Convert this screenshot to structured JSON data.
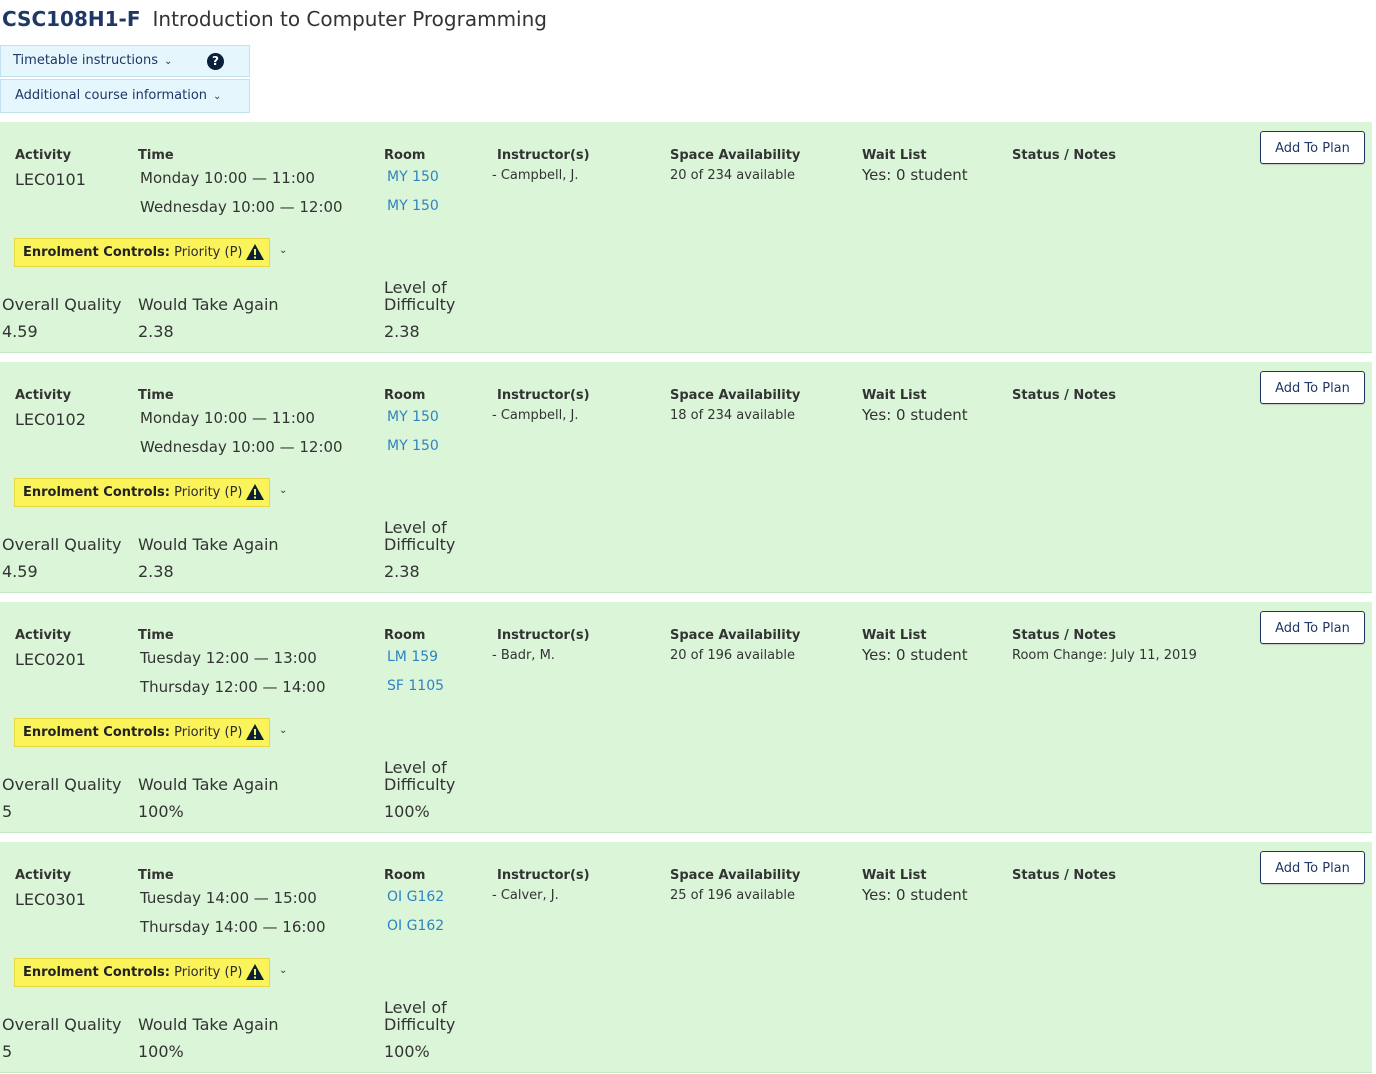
{
  "header": {
    "course_code": "CSC108H1-F",
    "course_title": "Introduction to Computer Programming"
  },
  "info_boxes": {
    "timetable_instructions": "Timetable instructions",
    "additional_info": "Additional course information",
    "help_icon": "?"
  },
  "labels": {
    "activity": "Activity",
    "time": "Time",
    "room": "Room",
    "instructors": "Instructor(s)",
    "space": "Space Availability",
    "waitlist": "Wait List",
    "status": "Status / Notes",
    "add_to_plan": "Add To Plan",
    "enrol_controls": "Enrolment Controls:",
    "overall_quality": "Overall Quality",
    "would_take_again": "Would Take Again",
    "level_of": "Level of",
    "difficulty": "Difficulty"
  },
  "icons": {
    "chevron": "chevron-down-icon",
    "warning": "warning-triangle-icon",
    "help": "question-circle-icon"
  },
  "colors": {
    "brand_navy": "#1e3765",
    "section_bg": "#dbf5d9",
    "enrol_bg": "#fbf35a",
    "room_link": "#2f83c2",
    "info_bg": "#e6f6fd"
  },
  "sections": [
    {
      "activity": "LEC0101",
      "time1": "Monday 10:00 — 11:00",
      "time2": "Wednesday 10:00 — 12:00",
      "room1": "MY 150",
      "room2": "MY 150",
      "instructor": "- Campbell, J.",
      "space": "20 of 234 available",
      "waitlist": "Yes: 0 student",
      "status": "",
      "enrol_value": "Priority (P)",
      "overall_quality": "4.59",
      "would_take_again": "2.38",
      "difficulty": "2.38"
    },
    {
      "activity": "LEC0102",
      "time1": "Monday 10:00 — 11:00",
      "time2": "Wednesday 10:00 — 12:00",
      "room1": "MY 150",
      "room2": "MY 150",
      "instructor": "- Campbell, J.",
      "space": "18 of 234 available",
      "waitlist": "Yes: 0 student",
      "status": "",
      "enrol_value": "Priority (P)",
      "overall_quality": "4.59",
      "would_take_again": "2.38",
      "difficulty": "2.38"
    },
    {
      "activity": "LEC0201",
      "time1": "Tuesday 12:00 — 13:00",
      "time2": "Thursday 12:00 — 14:00",
      "room1": "LM 159",
      "room2": "SF 1105",
      "instructor": "- Badr, M.",
      "space": "20 of 196 available",
      "waitlist": "Yes: 0 student",
      "status": "Room Change: July 11, 2019",
      "enrol_value": "Priority (P)",
      "overall_quality": "5",
      "would_take_again": "100%",
      "difficulty": "100%"
    },
    {
      "activity": "LEC0301",
      "time1": "Tuesday 14:00 — 15:00",
      "time2": "Thursday 14:00 — 16:00",
      "room1": "OI G162",
      "room2": "OI G162",
      "instructor": "- Calver, J.",
      "space": "25 of 196 available",
      "waitlist": "Yes: 0 student",
      "status": "",
      "enrol_value": "Priority (P)",
      "overall_quality": "5",
      "would_take_again": "100%",
      "difficulty": "100%"
    }
  ]
}
